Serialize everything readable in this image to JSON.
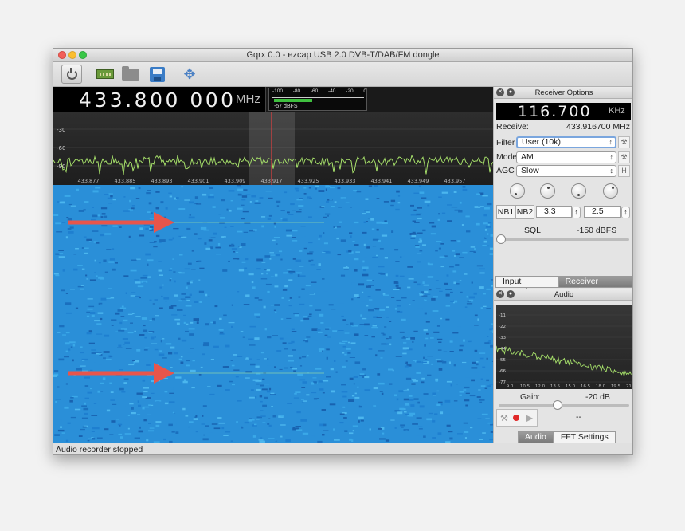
{
  "window": {
    "title": "Gqrx 0.0 - ezcap USB 2.0 DVB-T/DAB/FM dongle"
  },
  "colors": {
    "waterfall_bg": "#2a8fd8",
    "spectrum_trace": "#a6e06a",
    "arrow": "#e8554b",
    "marker": "#ff4040"
  },
  "toolbar": {
    "icons": [
      "power-icon",
      "device-icon",
      "folder-icon",
      "save-icon",
      "fullscreen-icon"
    ]
  },
  "main_freq": {
    "digits": "433.800 000",
    "unit": "MHz"
  },
  "meter": {
    "ticks": [
      "-100",
      "-80",
      "-60",
      "-40",
      "-20",
      "0"
    ],
    "label": "-57 dBFS",
    "level_dbfs": -57,
    "range": [
      -100,
      0
    ]
  },
  "spectrum": {
    "y_ticks": [
      "-30",
      "-60",
      "-90"
    ],
    "x_ticks": [
      "433.877",
      "433.885",
      "433.893",
      "433.901",
      "433.909",
      "433.917",
      "433.925",
      "433.933",
      "433.941",
      "433.949",
      "433.957"
    ]
  },
  "status": {
    "text": "Audio recorder stopped"
  },
  "receiver": {
    "title": "Receiver Options",
    "freq_digits": "116.700",
    "freq_unit": "KHz",
    "receive_label": "Receive:",
    "receive_value": "433.916700 MHz",
    "filter_label": "Filter",
    "filter_value": "User (10k)",
    "mode_label": "Mode",
    "mode_value": "AM",
    "agc_label": "AGC",
    "agc_value": "Slow",
    "agc_btn": "H",
    "nb1": "NB1",
    "nb2": "NB2",
    "nb1_value": "3.3",
    "nb2_value": "2.5",
    "sql_label": "SQL",
    "sql_value": "-150 dBFS"
  },
  "tabs_top": {
    "input": "Input controls",
    "receiver": "Receiver Options"
  },
  "audio": {
    "title": "Audio",
    "y_ticks": [
      "-11",
      "-22",
      "-33",
      "-44",
      "-55",
      "-66",
      "-77"
    ],
    "x_ticks": [
      "9.0",
      "10.5",
      "12.0",
      "13.5",
      "15.0",
      "16.5",
      "18.0",
      "19.5",
      "21.0"
    ],
    "gain_label": "Gain:",
    "gain_value": "-20 dB",
    "rec_time": "--"
  },
  "tabs_bottom": {
    "audio": "Audio",
    "fft": "FFT Settings"
  }
}
